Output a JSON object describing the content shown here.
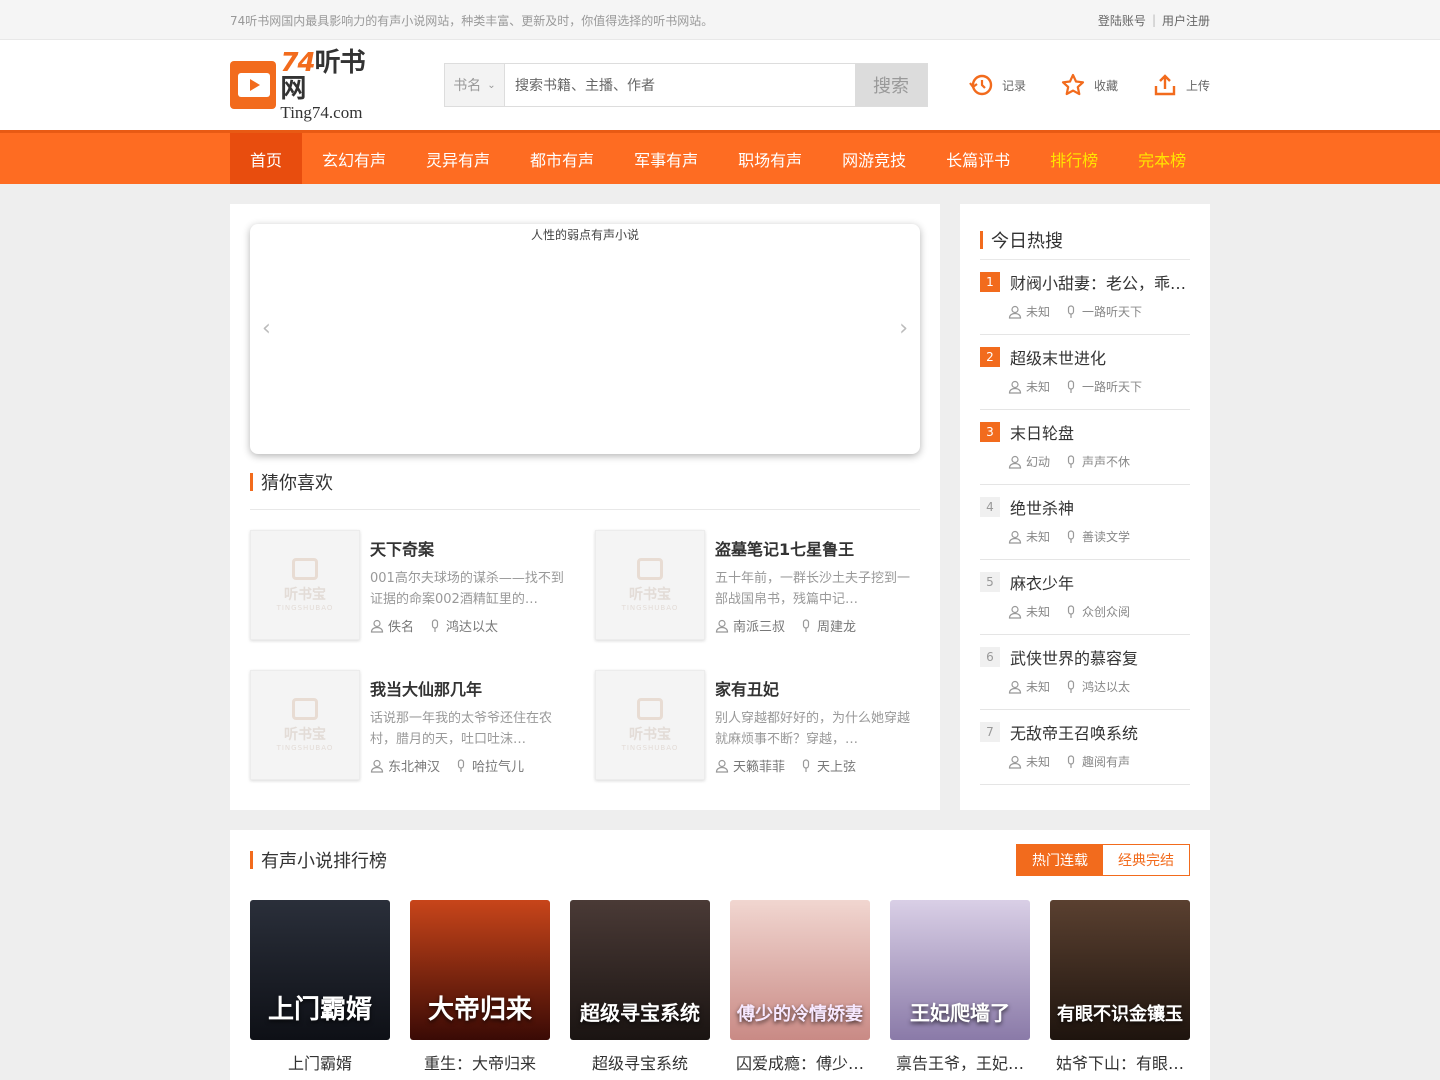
{
  "topbar": {
    "tagline": "74听书网国内最具影响力的有声小说网站，种类丰富、更新及时，你值得选择的听书网站。",
    "login": "登陆账号",
    "sep": "|",
    "register": "用户注册"
  },
  "logo": {
    "num": "74",
    "cn": "听书网",
    "en": "Ting74.com"
  },
  "search": {
    "type": "书名",
    "placeholder": "搜索书籍、主播、作者",
    "button": "搜索"
  },
  "tools": [
    {
      "label": "记录",
      "icon": "history-icon"
    },
    {
      "label": "收藏",
      "icon": "star-icon"
    },
    {
      "label": "上传",
      "icon": "upload-icon"
    }
  ],
  "nav": [
    "首页",
    "玄幻有声",
    "灵异有声",
    "都市有声",
    "军事有声",
    "职场有声",
    "网游竞技",
    "长篇评书",
    "排行榜",
    "完本榜"
  ],
  "banner": {
    "alt": "人性的弱点有声小说",
    "prev": "‹",
    "next": "›"
  },
  "guess": {
    "title": "猜你喜欢",
    "placeholder_cn": "听书宝",
    "placeholder_en": "TINGSHUBAO",
    "items": [
      {
        "name": "天下奇案",
        "desc": "001高尔夫球场的谋杀——找不到证据的命案002酒精缸里的…",
        "author": "佚名",
        "narrator": "鸿达以太"
      },
      {
        "name": "盗墓笔记1七星鲁王",
        "desc": "五十年前，一群长沙土夫子挖到一部战国帛书，残篇中记…",
        "author": "南派三叔",
        "narrator": "周建龙"
      },
      {
        "name": "我当大仙那几年",
        "desc": "话说那一年我的太爷爷还住在农村，腊月的天，吐口吐沫…",
        "author": "东北神汉",
        "narrator": "哈拉气儿"
      },
      {
        "name": "家有丑妃",
        "desc": "别人穿越都好好的，为什么她穿越就麻烦事不断？穿越，…",
        "author": "天籁菲菲",
        "narrator": "天上弦"
      }
    ]
  },
  "hot": {
    "title": "今日热搜",
    "items": [
      {
        "rank": "1",
        "name": "财阀小甜妻：老公，乖…",
        "author": "未知",
        "narrator": "一路听天下"
      },
      {
        "rank": "2",
        "name": "超级末世进化",
        "author": "未知",
        "narrator": "一路听天下"
      },
      {
        "rank": "3",
        "name": "末日轮盘",
        "author": "幻动",
        "narrator": "声声不休"
      },
      {
        "rank": "4",
        "name": "绝世杀神",
        "author": "未知",
        "narrator": "善读文学"
      },
      {
        "rank": "5",
        "name": "麻衣少年",
        "author": "未知",
        "narrator": "众创众阅"
      },
      {
        "rank": "6",
        "name": "武侠世界的慕容复",
        "author": "未知",
        "narrator": "鸿达以太"
      },
      {
        "rank": "7",
        "name": "无敌帝王召唤系统",
        "author": "未知",
        "narrator": "趣阅有声"
      }
    ]
  },
  "rank": {
    "title": "有声小说排行榜",
    "tab_hot": "热门连载",
    "tab_classic": "经典完结",
    "books": [
      {
        "title": "上门霸婿",
        "cover_text": "上门霸婿",
        "c1": "#2a2f3a",
        "c2": "#0e1016"
      },
      {
        "title": "重生：大帝归来",
        "cover_text": "大帝归来",
        "c1": "#c8451a",
        "c2": "#3a0a05"
      },
      {
        "title": "超级寻宝系统",
        "cover_text": "超级寻宝系统",
        "c1": "#4a3a36",
        "c2": "#1a1412"
      },
      {
        "title": "囚爱成瘾：傅少…",
        "cover_text": "傅少的冷情娇妻",
        "c1": "#f1d6d0",
        "c2": "#c98a85"
      },
      {
        "title": "禀告王爷，王妃…",
        "cover_text": "王妃爬墙了",
        "c1": "#d9cfe6",
        "c2": "#8a7aa8"
      },
      {
        "title": "姑爷下山：有眼…",
        "cover_text": "有眼不识金镶玉",
        "c1": "#5a4030",
        "c2": "#1e140e"
      }
    ]
  }
}
